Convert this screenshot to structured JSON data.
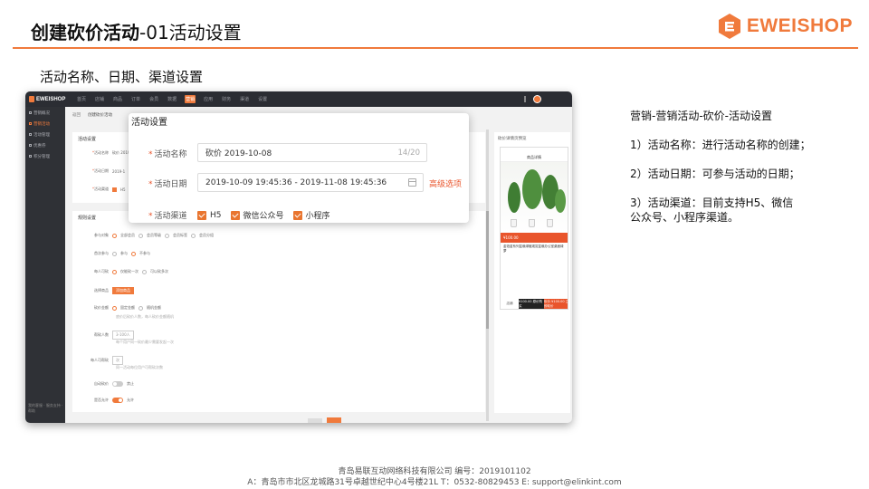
{
  "slide": {
    "title_bold": "创建砍价活动",
    "title_rest": "-01活动设置",
    "brand": "EWEISHOP",
    "section_heading": "活动名称、日期、渠道设置"
  },
  "app": {
    "topbar_logo": "EWEISHOP",
    "nav": [
      "首页",
      "店铺",
      "商品",
      "订单",
      "会员",
      "数据",
      "营销",
      "应用",
      "财务",
      "渠道",
      "设置"
    ],
    "sidebar": [
      "营销概况",
      "营销活动",
      "活动管理",
      "优惠券",
      "积分管理"
    ],
    "sidebar_footer": "我的客服 · 服务支持 · 帮助",
    "breadcrumb": [
      "返回",
      "创建砍价活动"
    ],
    "card1_title": "活动设置",
    "card1_rows": [
      {
        "label": "活动名称",
        "value": "砍价 2019-1"
      },
      {
        "label": "活动日期",
        "value": "2019-1"
      },
      {
        "label": "活动渠道",
        "value": "H5"
      }
    ],
    "card2_title": "规则设置",
    "rules": [
      {
        "label": "参与对象",
        "options": [
          "全部会员",
          "会员等级",
          "会员标签",
          "会员分组"
        ]
      },
      {
        "label": "首次参与",
        "options": [
          "参与",
          "不参与"
        ]
      },
      {
        "label": "每人可砍",
        "options": [
          "仅能砍一次",
          "可以砍多次"
        ]
      },
      {
        "label": "选择商品",
        "button": "添加商品"
      },
      {
        "label": "砍价金额",
        "options": [
          "固定金额",
          "随机金额"
        ],
        "hint": "底价后砍价人数，每人砍价金额随机"
      },
      {
        "label": "帮砍人数",
        "input": "3-100人",
        "hint": "每个用户同一砍价最少需要发起一次"
      },
      {
        "label": "每人可帮砍",
        "input": "次",
        "hint": "同一活动每位用户可帮砍次数"
      },
      {
        "label": "自动砍价",
        "toggle": "禁止"
      },
      {
        "label": "是否允许",
        "toggle": "允许"
      }
    ],
    "preview_title": "砍价详情页预览",
    "phone": {
      "header": "商品详情",
      "price": "¥100.00",
      "desc": "金铂苗系列盆栽绿植观赏盆栽办公室桌面绿萝",
      "foot_a": "店铺",
      "foot_b": "¥100.00 原价购买",
      "foot_c": "砍价 ¥100.00 立即砍价"
    }
  },
  "popup": {
    "title": "活动设置",
    "name_label": "活动名称",
    "name_value": "砍价  2019-10-08",
    "name_count": "14/20",
    "date_label": "活动日期",
    "date_value": "2019-10-09 19:45:36 - 2019-11-08 19:45:36",
    "advanced_link": "高级选项",
    "channel_label": "活动渠道",
    "channels": [
      "H5",
      "微信公众号",
      "小程序"
    ]
  },
  "description": {
    "heading": "营销-营销活动-砍价-活动设置",
    "item1": "1）活动名称：进行活动名称的创建；",
    "item2": "2）活动日期：可参与活动的日期；",
    "item3_line1": "3）活动渠道：目前支持H5、微信",
    "item3_line2": "公众号、小程序渠道。"
  },
  "footer": {
    "line1": "青岛易联互动网络科技有限公司    编号：2019101102",
    "line2": "A：青岛市市北区龙城路31号卓越世纪中心4号楼21L    T：0532-80829453    E: support@elinkint.com"
  },
  "colors": {
    "accent": "#f07a3c",
    "danger": "#e9552c",
    "dark_bar": "#2b2d33"
  }
}
